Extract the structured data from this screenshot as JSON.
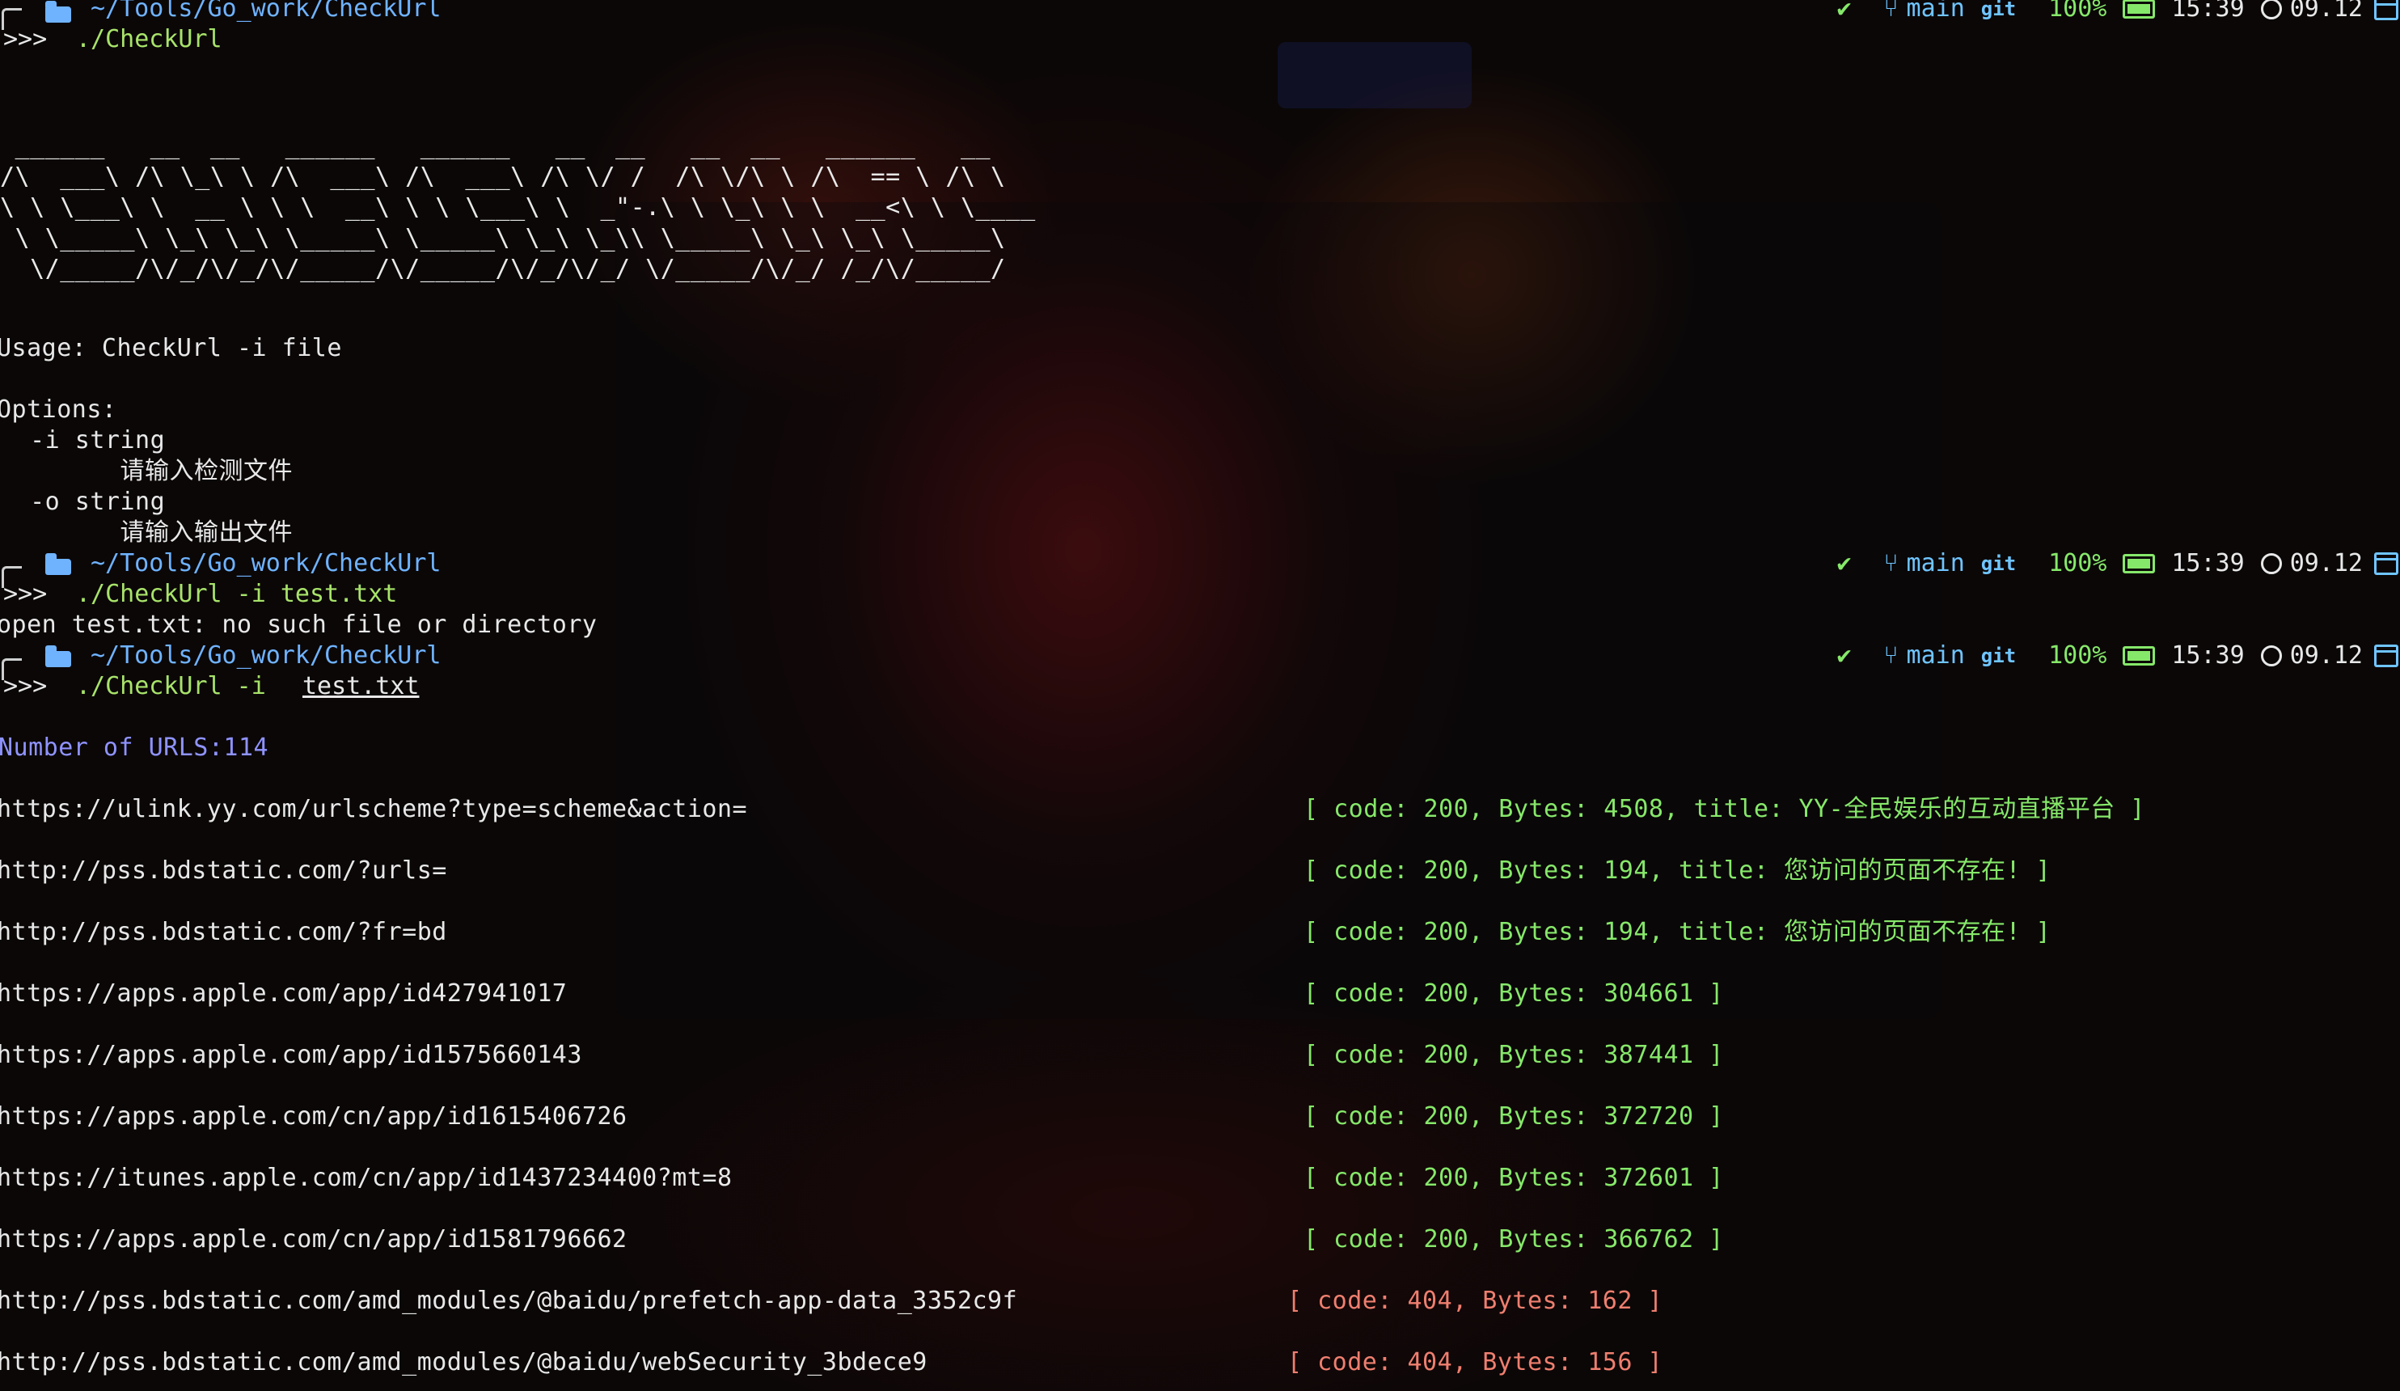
{
  "prompt": {
    "path": "~/Tools/Go_work/CheckUrl",
    "arrow": ">>>",
    "status": {
      "check": "✔",
      "branch_icon": "branch-icon",
      "branch": "main",
      "vcs": "git",
      "battery": "100%",
      "time": "15:39",
      "date": "09.12"
    }
  },
  "commands": {
    "first": "./CheckUrl",
    "second": "./CheckUrl -i test.txt",
    "third_cmd": "./CheckUrl -i ",
    "third_arg": "test.txt"
  },
  "banner": [
    " ______   __  __   ______   ______   __  __   __  __   ______   __",
    "/\\  ___\\ /\\ \\_\\ \\ /\\  ___\\ /\\  ___\\ /\\ \\/ /  /\\ \\/\\ \\ /\\  == \\ /\\ \\",
    "\\ \\ \\___\\ \\  __ \\ \\ \\  __\\ \\ \\ \\___\\ \\  _\"-.\\ \\ \\_\\ \\ \\  __<\\ \\ \\____",
    " \\ \\_____\\ \\_\\ \\_\\ \\_____\\ \\_____\\ \\_\\ \\_\\\\ \\_____\\ \\_\\ \\_\\ \\_____\\",
    "  \\/_____/\\/_/\\/_/\\/_____/\\/_____/\\/_/\\/_/ \\/_____/\\/_/ /_/\\/_____/"
  ],
  "usage": "Usage: CheckUrl -i file",
  "options_title": "Options:",
  "options": [
    {
      "flag": "  -i string",
      "desc": "        请输入检测文件"
    },
    {
      "flag": "  -o string",
      "desc": "        请输入输出文件"
    }
  ],
  "error_line": "open test.txt: no such file or directory",
  "count_line": "Number of URLS:114",
  "results": [
    {
      "url": "https://ulink.yy.com/urlscheme?type=scheme&action=",
      "info": "[ code: 200, Bytes: 4508, title: YY-全民娱乐的互动直播平台 ]",
      "ok": true
    },
    {
      "url": "http://pss.bdstatic.com/?urls=",
      "info": "[ code: 200, Bytes: 194, title: 您访问的页面不存在! ]",
      "ok": true
    },
    {
      "url": "http://pss.bdstatic.com/?fr=bd",
      "info": "[ code: 200, Bytes: 194, title: 您访问的页面不存在! ]",
      "ok": true
    },
    {
      "url": "https://apps.apple.com/app/id427941017",
      "info": "[ code: 200, Bytes: 304661 ]",
      "ok": true
    },
    {
      "url": "https://apps.apple.com/app/id1575660143",
      "info": "[ code: 200, Bytes: 387441 ]",
      "ok": true
    },
    {
      "url": "https://apps.apple.com/cn/app/id1615406726",
      "info": "[ code: 200, Bytes: 372720 ]",
      "ok": true
    },
    {
      "url": "https://itunes.apple.com/cn/app/id1437234400?mt=8",
      "info": "[ code: 200, Bytes: 372601 ]",
      "ok": true
    },
    {
      "url": "https://apps.apple.com/cn/app/id1581796662",
      "info": "[ code: 200, Bytes: 366762 ]",
      "ok": true
    },
    {
      "url": "http://pss.bdstatic.com/amd_modules/@baidu/prefetch-app-data_3352c9f",
      "info": "[ code: 404, Bytes: 162 ]",
      "ok": false
    },
    {
      "url": "http://pss.bdstatic.com/amd_modules/@baidu/webSecurity_3bdece9",
      "info": "[ code: 404, Bytes: 156 ]",
      "ok": false
    }
  ],
  "colors": {
    "path": "#6fb3ff",
    "command": "#a8e36a",
    "count": "#8f93ff",
    "ok": "#86e86a",
    "error": "#ef7f6f"
  }
}
